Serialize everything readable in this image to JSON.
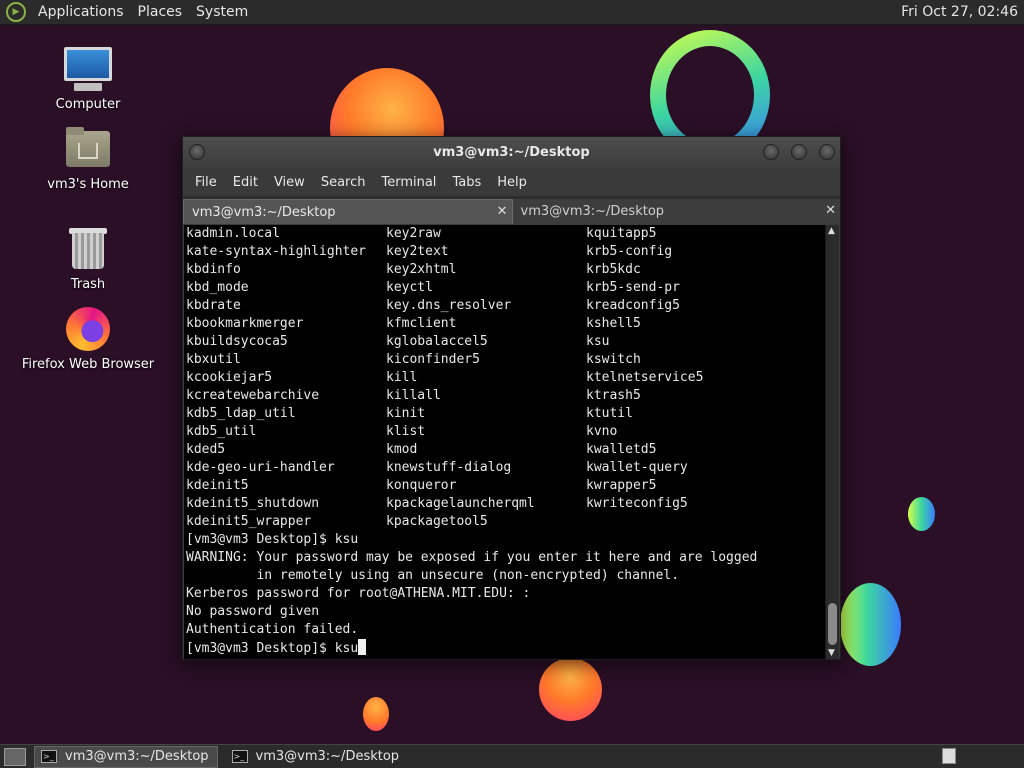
{
  "top_panel": {
    "menus": [
      "Applications",
      "Places",
      "System"
    ],
    "clock": "Fri Oct 27, 02:46"
  },
  "desktop_icons": [
    {
      "label": "Computer",
      "icon": "computer-icon"
    },
    {
      "label": "vm3's Home",
      "icon": "home-folder-icon"
    },
    {
      "label": "Trash",
      "icon": "trash-icon"
    },
    {
      "label": "Firefox Web Browser",
      "icon": "firefox-icon"
    }
  ],
  "window": {
    "title": "vm3@vm3:~/Desktop",
    "menu": [
      "File",
      "Edit",
      "View",
      "Search",
      "Terminal",
      "Tabs",
      "Help"
    ],
    "tabs": [
      {
        "label": "vm3@vm3:~/Desktop",
        "active": true
      },
      {
        "label": "vm3@vm3:~/Desktop",
        "active": false
      }
    ],
    "terminal": {
      "listing": [
        [
          "kadmin.local",
          "key2raw",
          "kquitapp5"
        ],
        [
          "kate-syntax-highlighter",
          "key2text",
          "krb5-config"
        ],
        [
          "kbdinfo",
          "key2xhtml",
          "krb5kdc"
        ],
        [
          "kbd_mode",
          "keyctl",
          "krb5-send-pr"
        ],
        [
          "kbdrate",
          "key.dns_resolver",
          "kreadconfig5"
        ],
        [
          "kbookmarkmerger",
          "kfmclient",
          "kshell5"
        ],
        [
          "kbuildsycoca5",
          "kglobalaccel5",
          "ksu"
        ],
        [
          "kbxutil",
          "kiconfinder5",
          "kswitch"
        ],
        [
          "kcookiejar5",
          "kill",
          "ktelnetservice5"
        ],
        [
          "kcreatewebarchive",
          "killall",
          "ktrash5"
        ],
        [
          "kdb5_ldap_util",
          "kinit",
          "ktutil"
        ],
        [
          "kdb5_util",
          "klist",
          "kvno"
        ],
        [
          "kded5",
          "kmod",
          "kwalletd5"
        ],
        [
          "kde-geo-uri-handler",
          "knewstuff-dialog",
          "kwallet-query"
        ],
        [
          "kdeinit5",
          "konqueror",
          "kwrapper5"
        ],
        [
          "kdeinit5_shutdown",
          "kpackagelauncherqml",
          "kwriteconfig5"
        ],
        [
          "kdeinit5_wrapper",
          "kpackagetool5",
          ""
        ]
      ],
      "lines": [
        "[vm3@vm3 Desktop]$ ksu",
        "WARNING: Your password may be exposed if you enter it here and are logged",
        "         in remotely using an unsecure (non-encrypted) channel.",
        "Kerberos password for root@ATHENA.MIT.EDU: :",
        "No password given",
        "Authentication failed."
      ],
      "prompt": "[vm3@vm3 Desktop]$ ksu"
    }
  },
  "taskbar": {
    "tasks": [
      {
        "label": "vm3@vm3:~/Desktop",
        "active": true
      },
      {
        "label": "vm3@vm3:~/Desktop",
        "active": false
      }
    ]
  }
}
